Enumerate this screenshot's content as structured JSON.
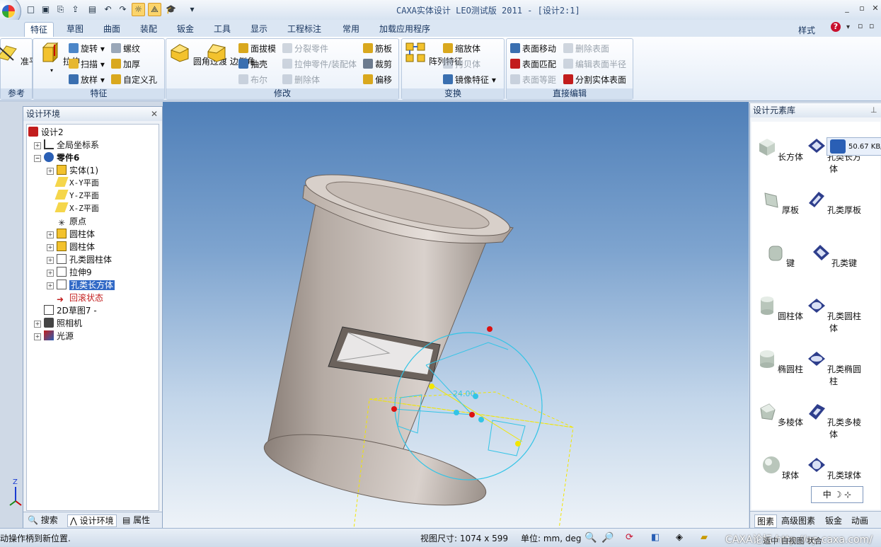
{
  "window": {
    "title": "CAXA实体设计 LEO测试版 2011 - [设计2:1]",
    "controls": [
      "_",
      "▫",
      "✕"
    ]
  },
  "quick_access": [
    "new-icon",
    "open-icon",
    "import-icon",
    "export-icon",
    "save-icon",
    "undo-icon",
    "redo-icon",
    "select-icon",
    "triball-icon",
    "hat-icon",
    "customize-icon"
  ],
  "tabs": [
    "特征",
    "草图",
    "曲面",
    "装配",
    "钣金",
    "工具",
    "显示",
    "工程标注",
    "常用",
    "加载应用程序"
  ],
  "tabs_right": {
    "style_label": "样式",
    "help": "?"
  },
  "ribbon": {
    "groups": [
      {
        "label": "参考",
        "big": [
          {
            "label": "准平面"
          }
        ]
      },
      {
        "label": "特征",
        "big": [
          {
            "label": "拉伸"
          }
        ],
        "small": [
          "旋转",
          "扫描",
          "放样",
          "螺纹",
          "加厚",
          "自定义孔"
        ]
      },
      {
        "label": "修改",
        "big": [
          {
            "label": "圆角过渡"
          },
          {
            "label": "边倒角"
          }
        ],
        "small": [
          "面拔模",
          "抽壳",
          "布尔",
          "分裂零件",
          "拉伸零件/装配体",
          "删除体",
          "筋板",
          "裁剪",
          "偏移"
        ]
      },
      {
        "label": "变换",
        "big": [
          {
            "label": "阵列特征"
          }
        ],
        "small": [
          "缩放体",
          "拷贝体",
          "镜像特征"
        ]
      },
      {
        "label": "直接编辑",
        "small": [
          "表面移动",
          "表面匹配",
          "表面等距",
          "删除表面",
          "编辑表面半径",
          "分割实体表面"
        ]
      }
    ]
  },
  "left_panel": {
    "title": "设计环境",
    "tree": [
      {
        "label": "设计2"
      },
      {
        "label": "全局坐标系"
      },
      {
        "label": "零件6"
      },
      {
        "label": "实体(1)"
      },
      {
        "label": "X-Y平面"
      },
      {
        "label": "Y-Z平面"
      },
      {
        "label": "X-Z平面"
      },
      {
        "label": "原点"
      },
      {
        "label": "圆柱体"
      },
      {
        "label": "圆柱体"
      },
      {
        "label": "孔类圆柱体"
      },
      {
        "label": "拉伸9"
      },
      {
        "label": "孔类长方体"
      },
      {
        "label": "回滚状态"
      },
      {
        "label": "2D草图7 -"
      },
      {
        "label": "照相机"
      },
      {
        "label": "光源"
      }
    ],
    "bottom_tabs": [
      "搜索",
      "设计环境",
      "属性"
    ]
  },
  "viewport": {
    "dimension_label": "24.00",
    "axis_label": "Z"
  },
  "right_panel": {
    "title": "设计元素库",
    "download_badge": "50.67 KB/",
    "items": [
      "长方体",
      "孔类长方体",
      "厚板",
      "孔类厚板",
      "键",
      "孔类键",
      "圆柱体",
      "孔类圆柱体",
      "椭圆柱",
      "孔类椭圆柱",
      "多棱体",
      "孔类多棱体",
      "球体",
      "孔类球体"
    ],
    "ime_bar": "中 ☽ ⊹",
    "bottom_tabs": [
      "图素",
      "高级图素",
      "钣金",
      "动画"
    ]
  },
  "statusbar": {
    "message": "拖动操作柄到新位置.",
    "view_size": "视图尺寸: 1074 x  599",
    "units": "单位: mm, deg",
    "watermark": "CAXA论坛 http://op.caxa.com/",
    "tail": "适中  自视图   状合"
  },
  "colors": {
    "accent": "#3169c6",
    "highlight": "#fbd46b",
    "rollback_red": "#c21d1d",
    "handle_cyan": "#33c4e6",
    "handle_yellow": "#f2e600"
  }
}
